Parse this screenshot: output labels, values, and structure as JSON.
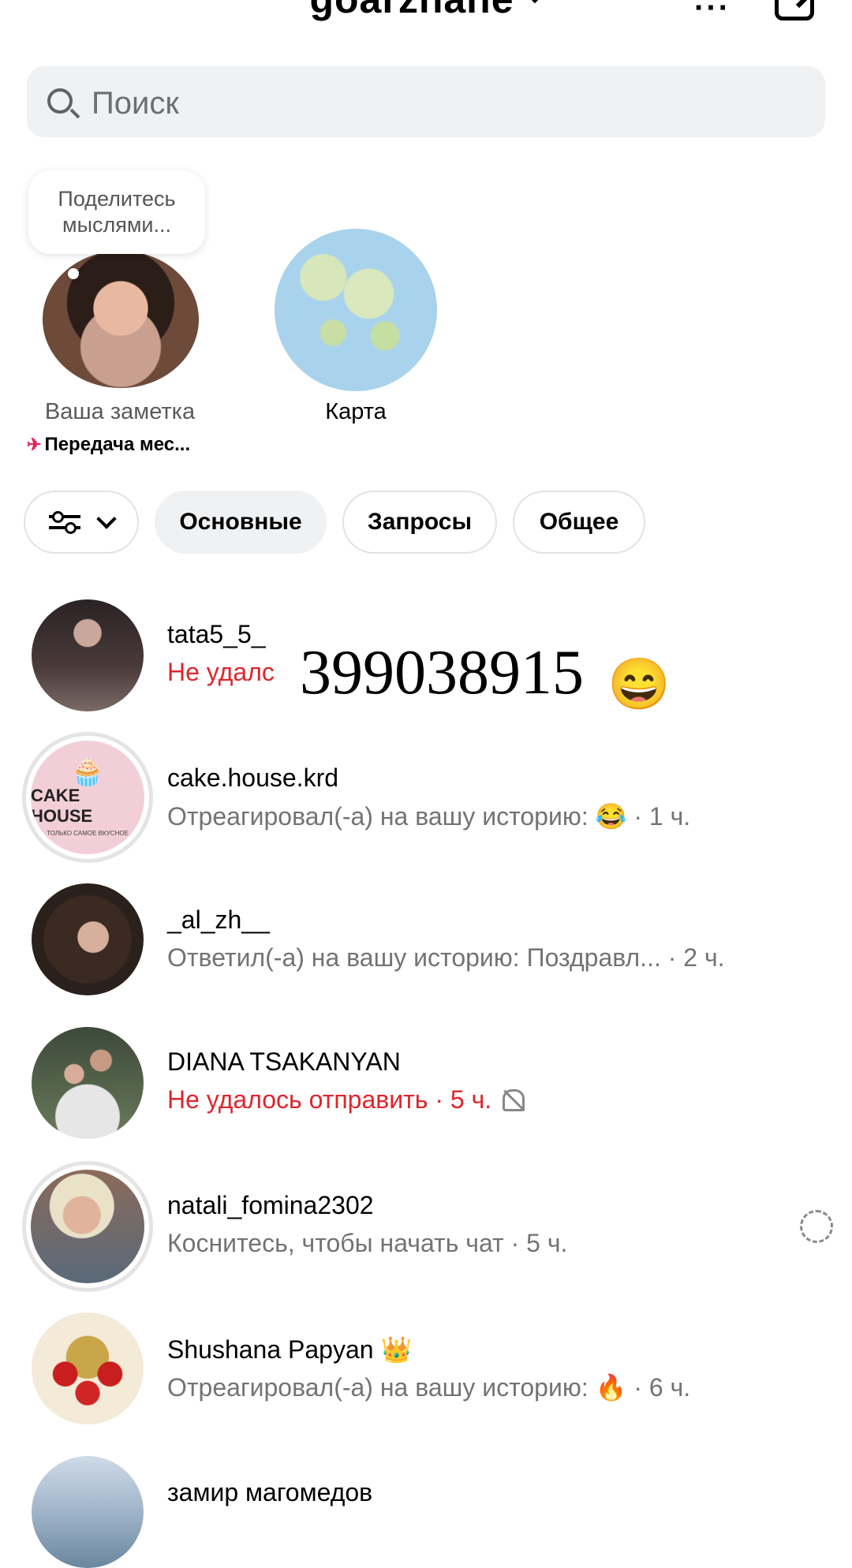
{
  "header": {
    "title": "goarzhane"
  },
  "search": {
    "placeholder": "Поиск"
  },
  "notes": [
    {
      "bubble": "Поделитесь мыслями...",
      "caption": "Ваша заметка",
      "status": "Передача мес..."
    },
    {
      "caption": "Карта"
    }
  ],
  "filters": [
    "Основные",
    "Запросы",
    "Общее"
  ],
  "overlay": {
    "number": "399038915",
    "emoji": "😄"
  },
  "threads": [
    {
      "name": "tata5_5_",
      "sub": "Не удалс",
      "sub_color": "#e0242c"
    },
    {
      "name": "cake.house.krd",
      "sub": "Отреагировал(-а) на вашу историю: 😂 · 1 ч.",
      "avatar_title": "CAKE HOUSE",
      "avatar_sub": "ТОЛЬКО САМОЕ ВКУСНОЕ"
    },
    {
      "name": "_al_zh__",
      "sub": "Ответил(-а) на вашу историю: Поздравл...   · 2 ч."
    },
    {
      "name": "DIANA TSAKANYAN",
      "sub": "Не удалось отправить · 5 ч.",
      "sub_color": "#e0242c"
    },
    {
      "name": "natali_fomina2302",
      "sub": "Коснитесь, чтобы начать чат · 5 ч."
    },
    {
      "name": "Shushana Papyan 👑",
      "sub": "Отреагировал(-а) на вашу историю: 🔥 · 6 ч."
    },
    {
      "name": "замир магомедов"
    }
  ],
  "colors": {
    "accent_red": "#e0242c",
    "search_bg": "#eff1f3"
  }
}
